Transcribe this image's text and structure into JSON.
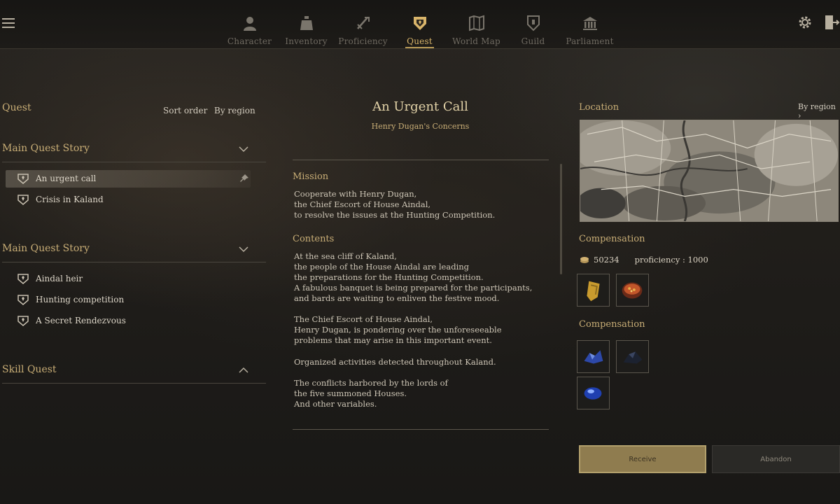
{
  "nav": {
    "items": [
      {
        "label": "Character",
        "icon": "character-icon"
      },
      {
        "label": "Inventory",
        "icon": "inventory-icon"
      },
      {
        "label": "Proficiency",
        "icon": "proficiency-icon"
      },
      {
        "label": "Quest",
        "icon": "quest-icon",
        "active": true
      },
      {
        "label": "World Map",
        "icon": "world-map-icon"
      },
      {
        "label": "Guild",
        "icon": "guild-icon"
      },
      {
        "label": "Parliament",
        "icon": "parliament-icon"
      }
    ],
    "active_color": "#d8b46a",
    "inactive_color": "#6f6a61"
  },
  "left": {
    "title": "Quest",
    "sort_label": "Sort order",
    "sort_value": "By region",
    "groups": [
      {
        "title": "Main Quest Story",
        "expanded": true,
        "items": [
          "An urgent call",
          "Crisis in Kaland"
        ]
      },
      {
        "title": "Main Quest Story",
        "expanded": true,
        "items": [
          "Aindal heir",
          "Hunting competition",
          "A Secret Rendezvous"
        ]
      },
      {
        "title": "Skill Quest",
        "expanded": false,
        "items": []
      }
    ],
    "selected_item": "An urgent call"
  },
  "center": {
    "title": "An Urgent Call",
    "subtitle": "Henry Dugan's Concerns",
    "mission_head": "Mission",
    "mission_text": "Cooperate with Henry Dugan,\nthe Chief Escort of House Aindal,\nto resolve the issues at the Hunting Competition.",
    "contents_head": "Contents",
    "contents_p1": "At the sea cliff of Kaland,\nthe people of the House Aindal are leading\nthe preparations for the Hunting Competition.\nA fabulous banquet is being prepared for the participants,\nand bards are waiting to enliven the festive mood.",
    "contents_p2": "The Chief Escort of House Aindal,\nHenry Dugan, is pondering over the unforeseeable\nproblems that may arise in this important event.",
    "contents_p3": "Organized activities detected throughout Kaland.",
    "contents_p4": "The conflicts harbored by the lords of\nthe five summoned Houses.\nAnd other variables."
  },
  "right": {
    "location_head": "Location",
    "by_region": "By region",
    "compensation_head_1": "Compensation",
    "currency_value": "50234",
    "proficiency_text": "proficiency : 1000",
    "rewards_1": [
      "gold-shield-item",
      "food-bowl-item"
    ],
    "compensation_head_2": "Compensation",
    "rewards_2": [
      "blue-crystal-item",
      "dark-ore-item",
      "blue-gem-item"
    ],
    "receive_label": "Receive",
    "abandon_label": "Abandon",
    "accent": "#b89a56"
  }
}
